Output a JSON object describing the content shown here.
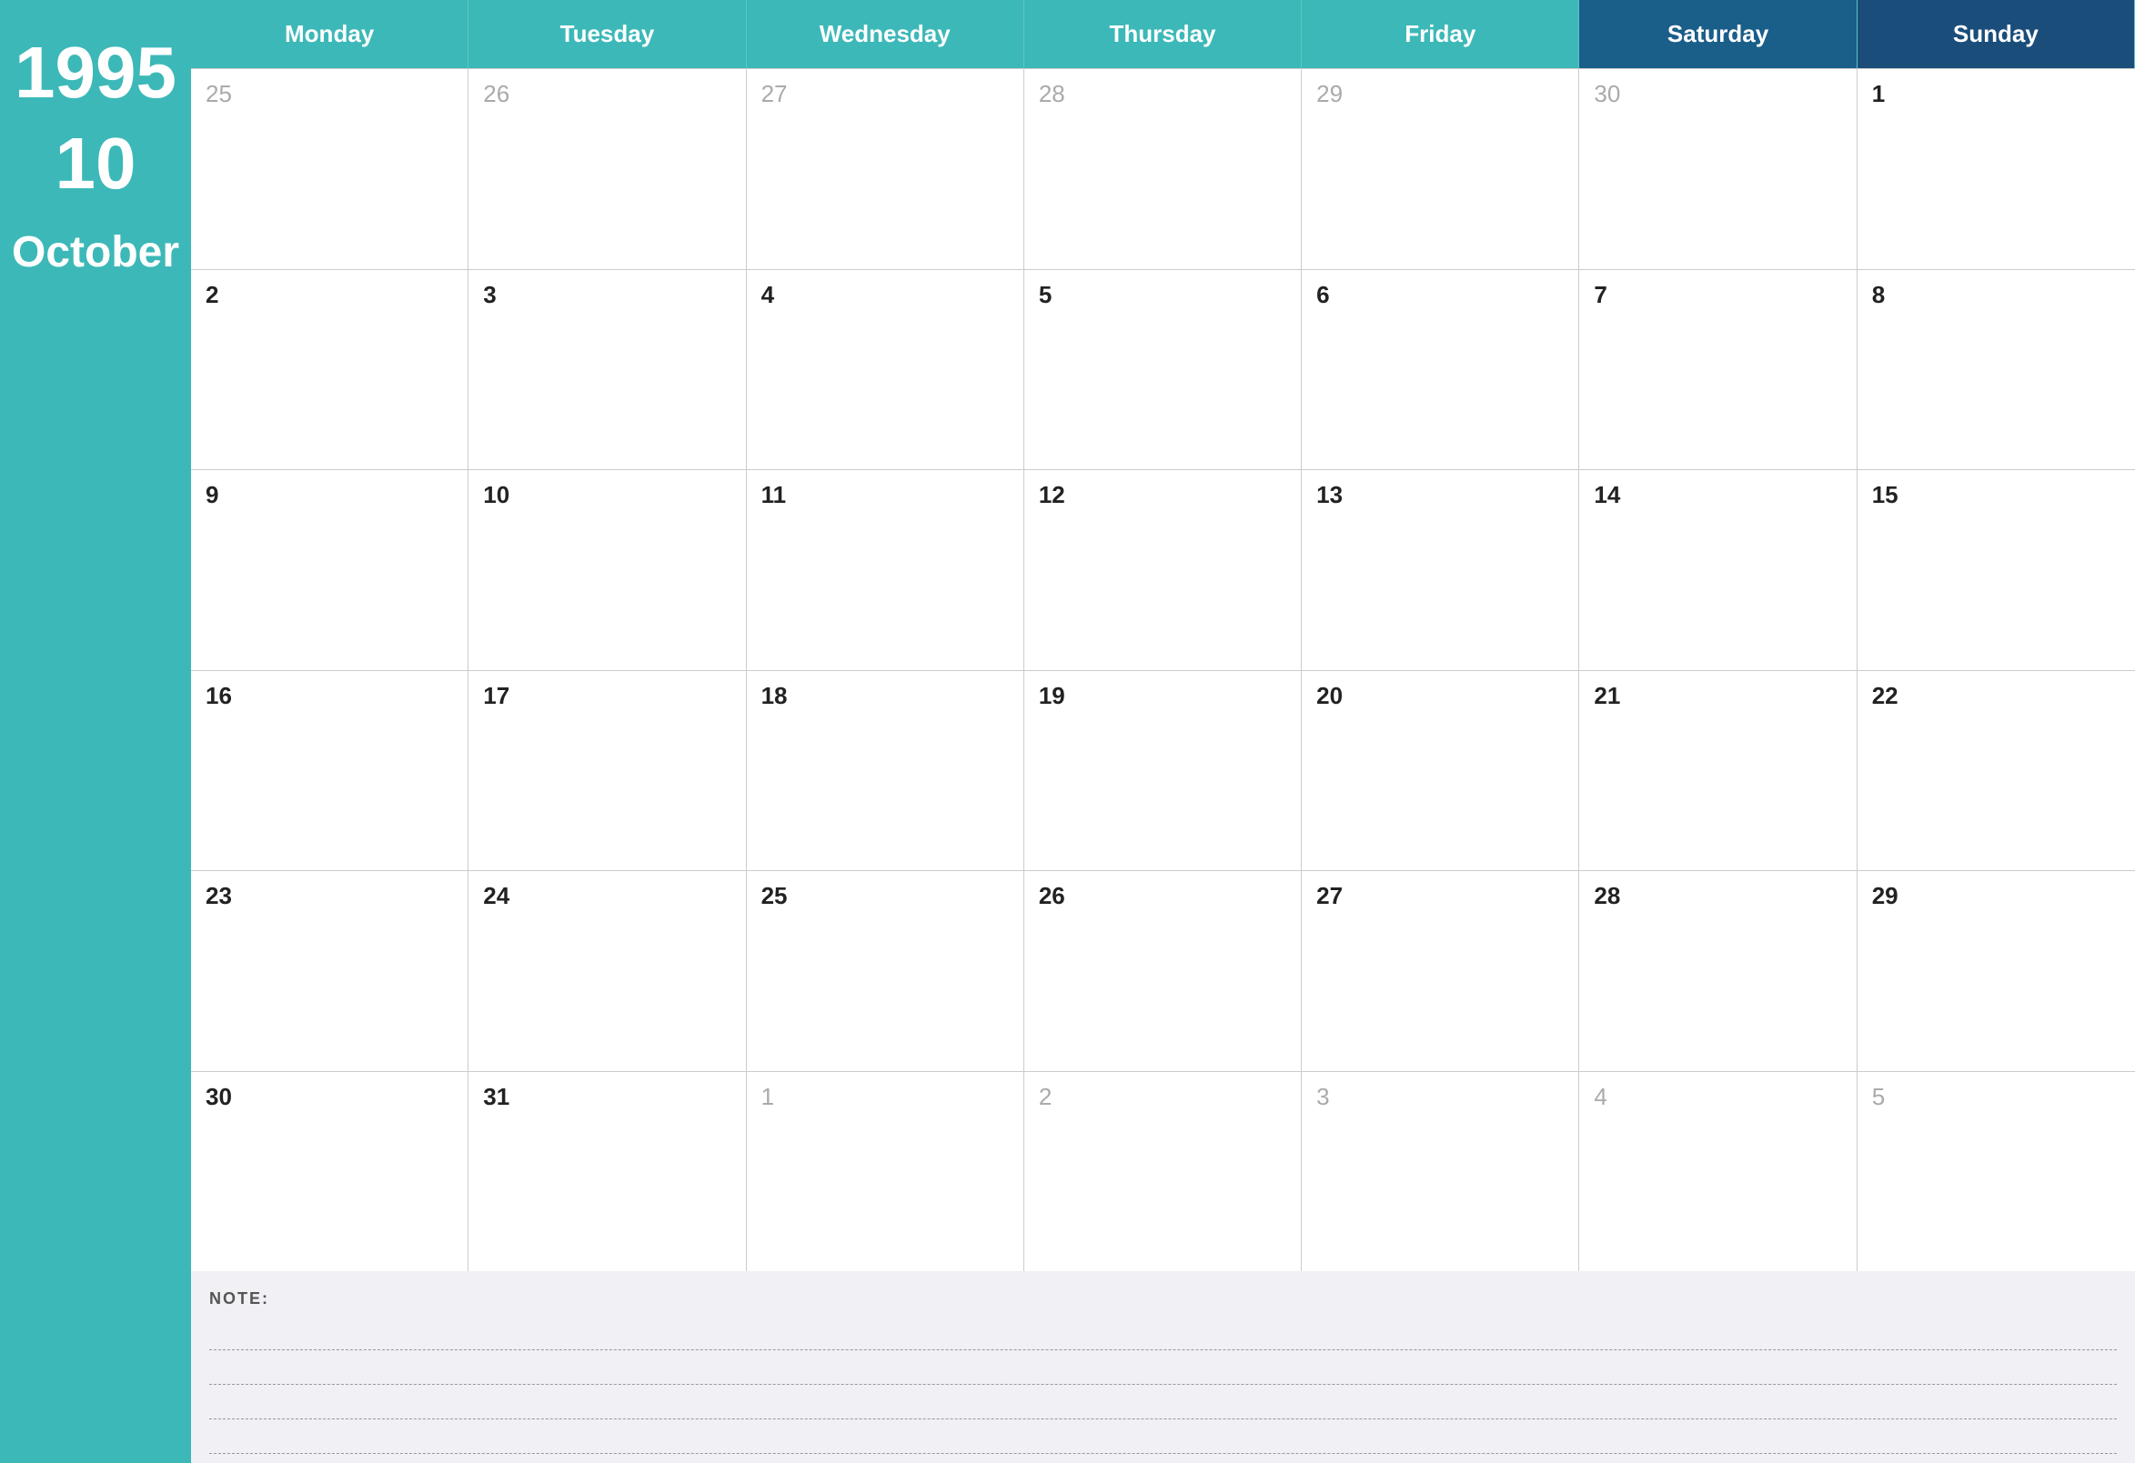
{
  "sidebar": {
    "year": "1995",
    "month_num": "10",
    "month_name": "October"
  },
  "headers": [
    {
      "label": "Monday",
      "type": "weekday"
    },
    {
      "label": "Tuesday",
      "type": "weekday"
    },
    {
      "label": "Wednesday",
      "type": "weekday"
    },
    {
      "label": "Thursday",
      "type": "weekday"
    },
    {
      "label": "Friday",
      "type": "weekday"
    },
    {
      "label": "Saturday",
      "type": "saturday"
    },
    {
      "label": "Sunday",
      "type": "sunday"
    }
  ],
  "weeks": [
    [
      {
        "num": "25",
        "type": "other"
      },
      {
        "num": "26",
        "type": "other"
      },
      {
        "num": "27",
        "type": "other"
      },
      {
        "num": "28",
        "type": "other"
      },
      {
        "num": "29",
        "type": "other"
      },
      {
        "num": "30",
        "type": "other"
      },
      {
        "num": "1",
        "type": "current"
      }
    ],
    [
      {
        "num": "2",
        "type": "current"
      },
      {
        "num": "3",
        "type": "current"
      },
      {
        "num": "4",
        "type": "current"
      },
      {
        "num": "5",
        "type": "current"
      },
      {
        "num": "6",
        "type": "current"
      },
      {
        "num": "7",
        "type": "current"
      },
      {
        "num": "8",
        "type": "current"
      }
    ],
    [
      {
        "num": "9",
        "type": "current"
      },
      {
        "num": "10",
        "type": "current"
      },
      {
        "num": "11",
        "type": "current"
      },
      {
        "num": "12",
        "type": "current"
      },
      {
        "num": "13",
        "type": "current"
      },
      {
        "num": "14",
        "type": "current"
      },
      {
        "num": "15",
        "type": "current"
      }
    ],
    [
      {
        "num": "16",
        "type": "current"
      },
      {
        "num": "17",
        "type": "current"
      },
      {
        "num": "18",
        "type": "current"
      },
      {
        "num": "19",
        "type": "current"
      },
      {
        "num": "20",
        "type": "current"
      },
      {
        "num": "21",
        "type": "current"
      },
      {
        "num": "22",
        "type": "current"
      }
    ],
    [
      {
        "num": "23",
        "type": "current"
      },
      {
        "num": "24",
        "type": "current"
      },
      {
        "num": "25",
        "type": "current"
      },
      {
        "num": "26",
        "type": "current"
      },
      {
        "num": "27",
        "type": "current"
      },
      {
        "num": "28",
        "type": "current"
      },
      {
        "num": "29",
        "type": "current"
      }
    ],
    [
      {
        "num": "30",
        "type": "current"
      },
      {
        "num": "31",
        "type": "current"
      },
      {
        "num": "1",
        "type": "other"
      },
      {
        "num": "2",
        "type": "other"
      },
      {
        "num": "3",
        "type": "other"
      },
      {
        "num": "4",
        "type": "other"
      },
      {
        "num": "5",
        "type": "other"
      }
    ]
  ],
  "notes": {
    "label": "NOTE:",
    "lines": 4
  }
}
